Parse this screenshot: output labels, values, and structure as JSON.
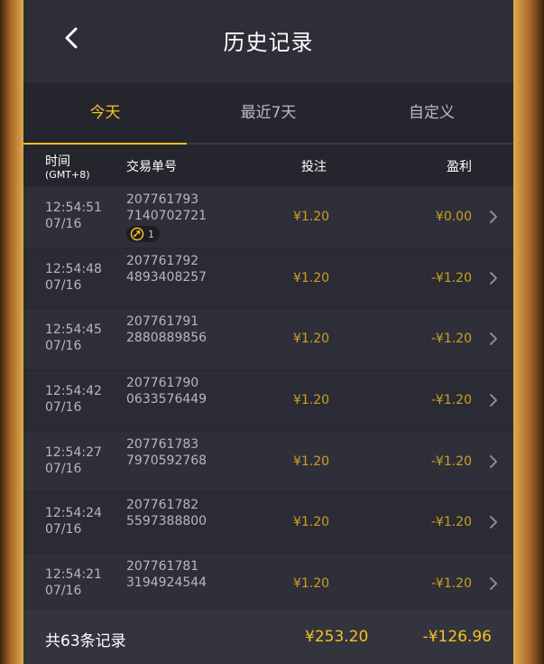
{
  "header": {
    "title": "历史记录"
  },
  "tabs": [
    {
      "label": "今天",
      "active": true
    },
    {
      "label": "最近7天",
      "active": false
    },
    {
      "label": "自定义",
      "active": false
    }
  ],
  "columns": {
    "time": "时间",
    "gmt": "(GMT+8)",
    "order": "交易单号",
    "bet": "投注",
    "profit": "盈利"
  },
  "rows": [
    {
      "time": "12:54:51",
      "date": "07/16",
      "order_line1": "207761793",
      "order_line2": "7140702721",
      "bet": "¥1.20",
      "profit": "¥0.00",
      "badge_count": "1"
    },
    {
      "time": "12:54:48",
      "date": "07/16",
      "order_line1": "207761792",
      "order_line2": "4893408257",
      "bet": "¥1.20",
      "profit": "-¥1.20"
    },
    {
      "time": "12:54:45",
      "date": "07/16",
      "order_line1": "207761791",
      "order_line2": "2880889856",
      "bet": "¥1.20",
      "profit": "-¥1.20"
    },
    {
      "time": "12:54:42",
      "date": "07/16",
      "order_line1": "207761790",
      "order_line2": "0633576449",
      "bet": "¥1.20",
      "profit": "-¥1.20"
    },
    {
      "time": "12:54:27",
      "date": "07/16",
      "order_line1": "207761783",
      "order_line2": "7970592768",
      "bet": "¥1.20",
      "profit": "-¥1.20"
    },
    {
      "time": "12:54:24",
      "date": "07/16",
      "order_line1": "207761782",
      "order_line2": "5597388800",
      "bet": "¥1.20",
      "profit": "-¥1.20"
    },
    {
      "time": "12:54:21",
      "date": "07/16",
      "order_line1": "207761781",
      "order_line2": "3194924544",
      "bet": "¥1.20",
      "profit": "-¥1.20"
    }
  ],
  "footer": {
    "total_label": "共63条记录",
    "total_bet": "¥253.20",
    "total_profit": "-¥126.96"
  },
  "colors": {
    "accent": "#f5c31e",
    "amount": "#c9a21f",
    "panel_bg": "#2a2a33"
  }
}
